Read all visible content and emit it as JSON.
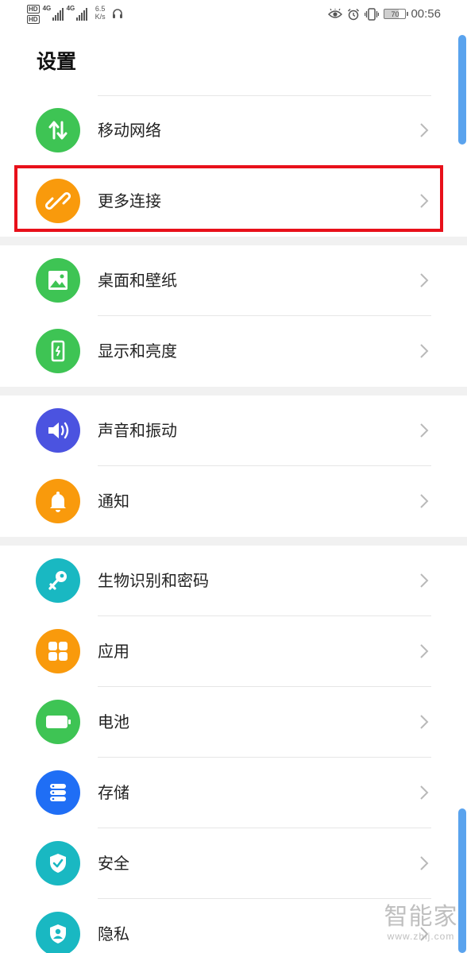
{
  "status_bar": {
    "hd1": "HD",
    "hd2": "HD",
    "sim1_label": "4G",
    "sim2_label": "4G",
    "speed_value": "6.5",
    "speed_unit": "K/s",
    "battery": "70",
    "time": "00:56"
  },
  "page": {
    "title": "设置"
  },
  "colors": {
    "green": "#3ec454",
    "orange": "#f99a0c",
    "indigo": "#4b53e0",
    "teal": "#19b8c2",
    "blue": "#1f6ef5",
    "highlight_red": "#e8101a"
  },
  "groups": [
    {
      "items": [
        {
          "label": "移动网络",
          "icon": "mobile-data-icon",
          "color": "#3ec454"
        },
        {
          "label": "更多连接",
          "icon": "link-icon",
          "color": "#f99a0c"
        }
      ]
    },
    {
      "items": [
        {
          "label": "桌面和壁纸",
          "icon": "wallpaper-icon",
          "color": "#3ec454"
        },
        {
          "label": "显示和亮度",
          "icon": "display-brightness-icon",
          "color": "#3ec454"
        }
      ]
    },
    {
      "items": [
        {
          "label": "声音和振动",
          "icon": "speaker-icon",
          "color": "#4b53e0"
        },
        {
          "label": "通知",
          "icon": "bell-icon",
          "color": "#f99a0c"
        }
      ]
    },
    {
      "items": [
        {
          "label": "生物识别和密码",
          "icon": "key-icon",
          "color": "#19b8c2"
        },
        {
          "label": "应用",
          "icon": "apps-grid-icon",
          "color": "#f99a0c"
        },
        {
          "label": "电池",
          "icon": "battery-icon",
          "color": "#3ec454"
        },
        {
          "label": "存储",
          "icon": "storage-icon",
          "color": "#1f6ef5"
        },
        {
          "label": "安全",
          "icon": "shield-check-icon",
          "color": "#19b8c2"
        },
        {
          "label": "隐私",
          "icon": "privacy-icon",
          "color": "#19b8c2"
        }
      ]
    }
  ],
  "watermark": {
    "main": "智能家",
    "url": "www.zhij.com"
  }
}
